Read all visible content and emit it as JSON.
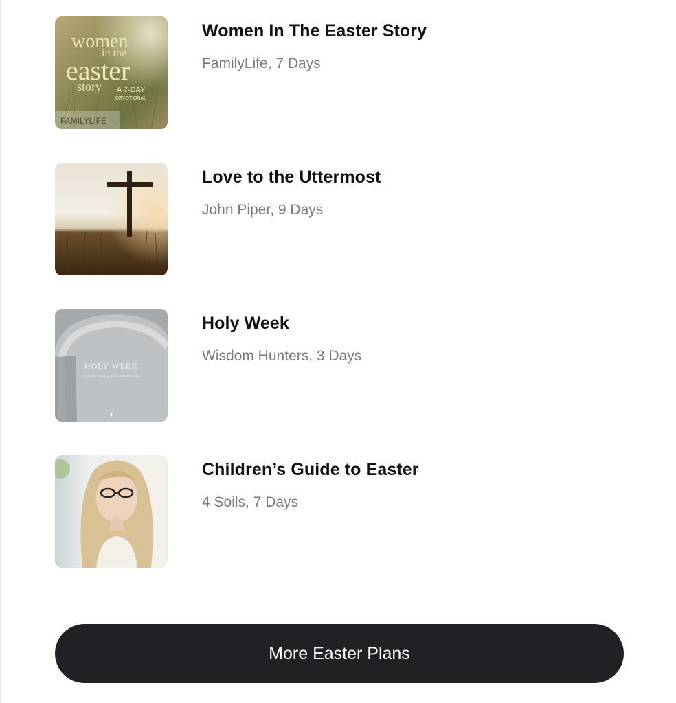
{
  "plans": [
    {
      "title": "Women In The Easter Story",
      "meta": "FamilyLife, 7 Days",
      "cover": {
        "line1": "women",
        "line2": "in the",
        "line3": "easter",
        "line4": "story",
        "tag1": "A 7-DAY",
        "tag2": "DEVOTIONAL",
        "brand": "FAMILYLIFE"
      }
    },
    {
      "title": "Love to the Uttermost",
      "meta": "John Piper, 9 Days"
    },
    {
      "title": "Holy Week",
      "meta": "Wisdom Hunters, 3 Days",
      "cover": {
        "heading": "HOLY WEEK",
        "sub": "A three-day reading plan from Wisdom Hunters"
      }
    },
    {
      "title": "Children’s Guide to Easter",
      "meta": "4 Soils, 7 Days"
    }
  ],
  "more_button": {
    "label": "More Easter Plans"
  }
}
